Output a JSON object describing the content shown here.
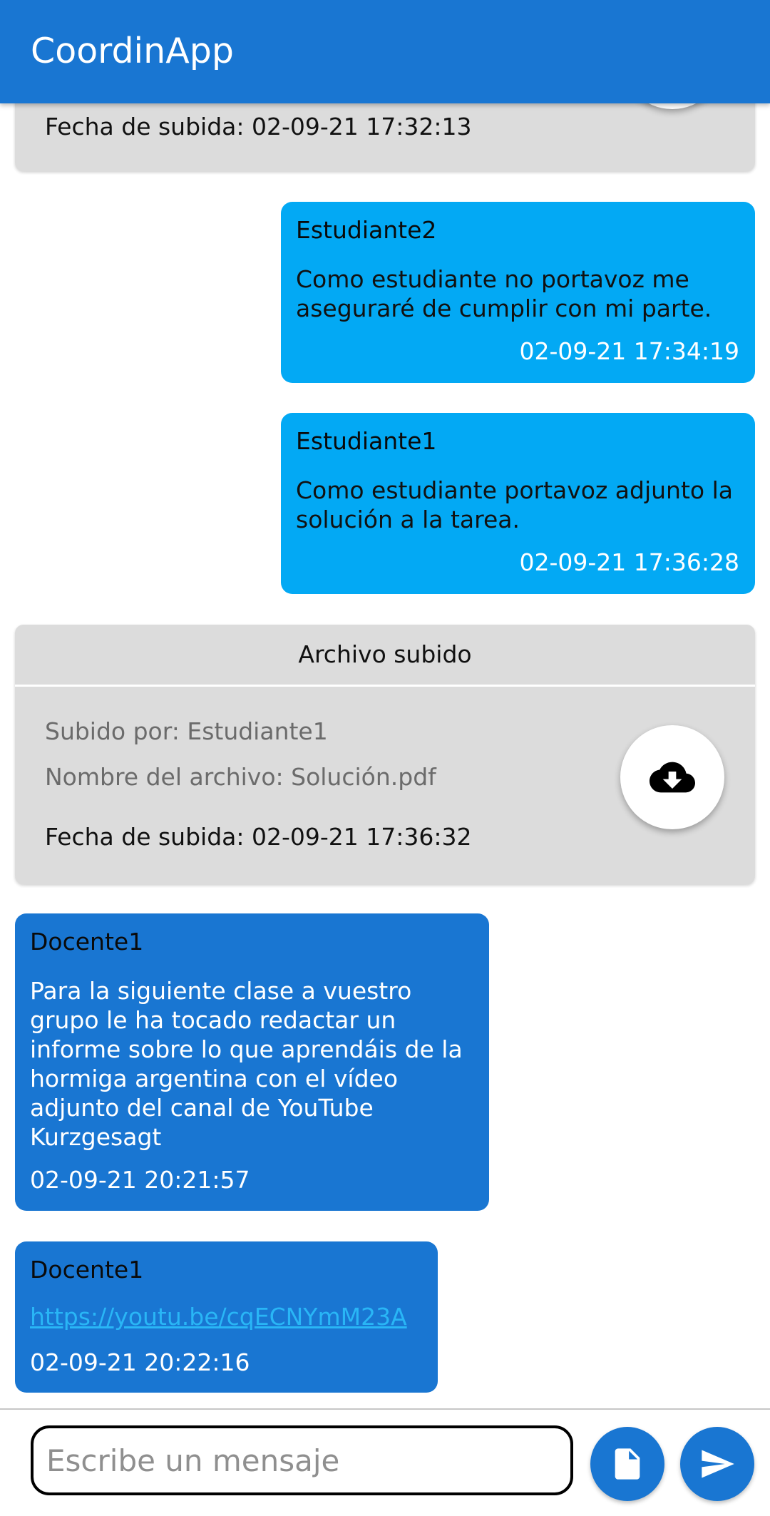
{
  "app": {
    "title": "CoordinApp"
  },
  "upload_card_partial": {
    "date_text": "Fecha de subida: 02-09-21 17:32:13",
    "button_icon": "cloud-download-icon"
  },
  "messages": [
    {
      "sender": "Estudiante2",
      "text": "Como estudiante no portavoz me aseguraré de cumplir con mi parte.",
      "time": "02-09-21 17:34:19"
    },
    {
      "sender": "Estudiante1",
      "text": "Como estudiante portavoz adjunto la solución a la tarea.",
      "time": "02-09-21 17:36:28"
    },
    {
      "sender": "Docente1",
      "text": "Para la siguiente clase a vuestro grupo le ha tocado redactar un informe sobre lo que aprendáis de la hormiga argentina con el vídeo adjunto del canal de YouTube Kurzgesagt",
      "time": "02-09-21 20:21:57"
    },
    {
      "sender": "Docente1",
      "link": "https://youtu.be/cqECNYmM23A",
      "time": "02-09-21 20:22:16"
    }
  ],
  "upload_card": {
    "title": "Archivo subido",
    "uploaded_by": "Subido por: Estudiante1",
    "file_name": "Nombre del archivo: Solución.pdf",
    "date_text": "Fecha de subida: 02-09-21 17:36:32",
    "button_icon": "cloud-download-icon"
  },
  "composer": {
    "placeholder": "Escribe un mensaje",
    "attach_icon": "file-icon",
    "send_icon": "send-icon"
  },
  "colors": {
    "primary": "#1976d2",
    "own_bubble": "#03a9f4",
    "card_background": "#dcdcdc",
    "link": "#29b6f6"
  }
}
